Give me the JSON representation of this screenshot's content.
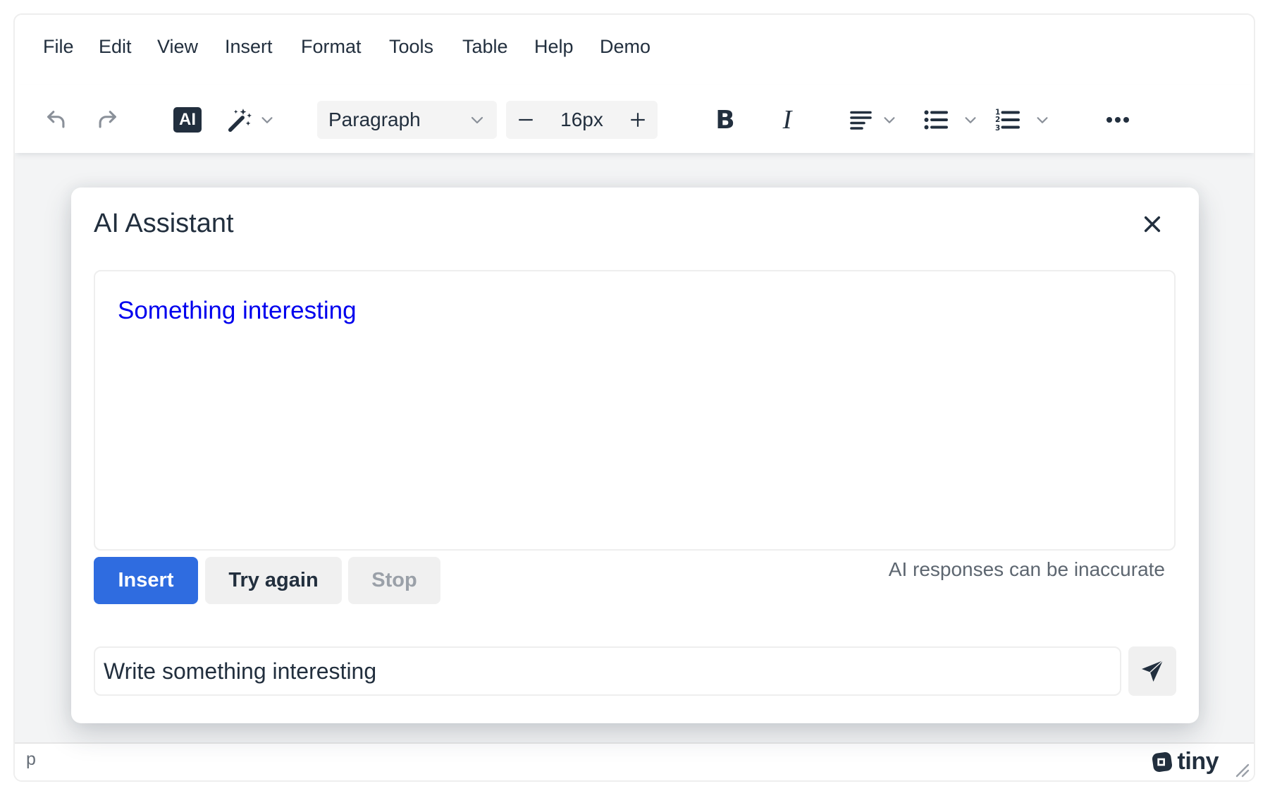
{
  "menubar": {
    "items": [
      "File",
      "Edit",
      "View",
      "Insert",
      "Format",
      "Tools",
      "Table",
      "Help",
      "Demo"
    ]
  },
  "toolbar": {
    "ai_badge": "AI",
    "block_format": "Paragraph",
    "font_size": "16px",
    "bold": "B",
    "italic": "I"
  },
  "dialog": {
    "title": "AI Assistant",
    "response_text": "Something interesting",
    "insert_label": "Insert",
    "try_again_label": "Try again",
    "stop_label": "Stop",
    "disclaimer": "AI responses can be inaccurate",
    "prompt_value": "Write something interesting"
  },
  "statusbar": {
    "path": "p",
    "brand": "tiny"
  },
  "colors": {
    "accent": "#2f6ce0",
    "response_text": "#0000ee",
    "text": "#222f3e"
  }
}
